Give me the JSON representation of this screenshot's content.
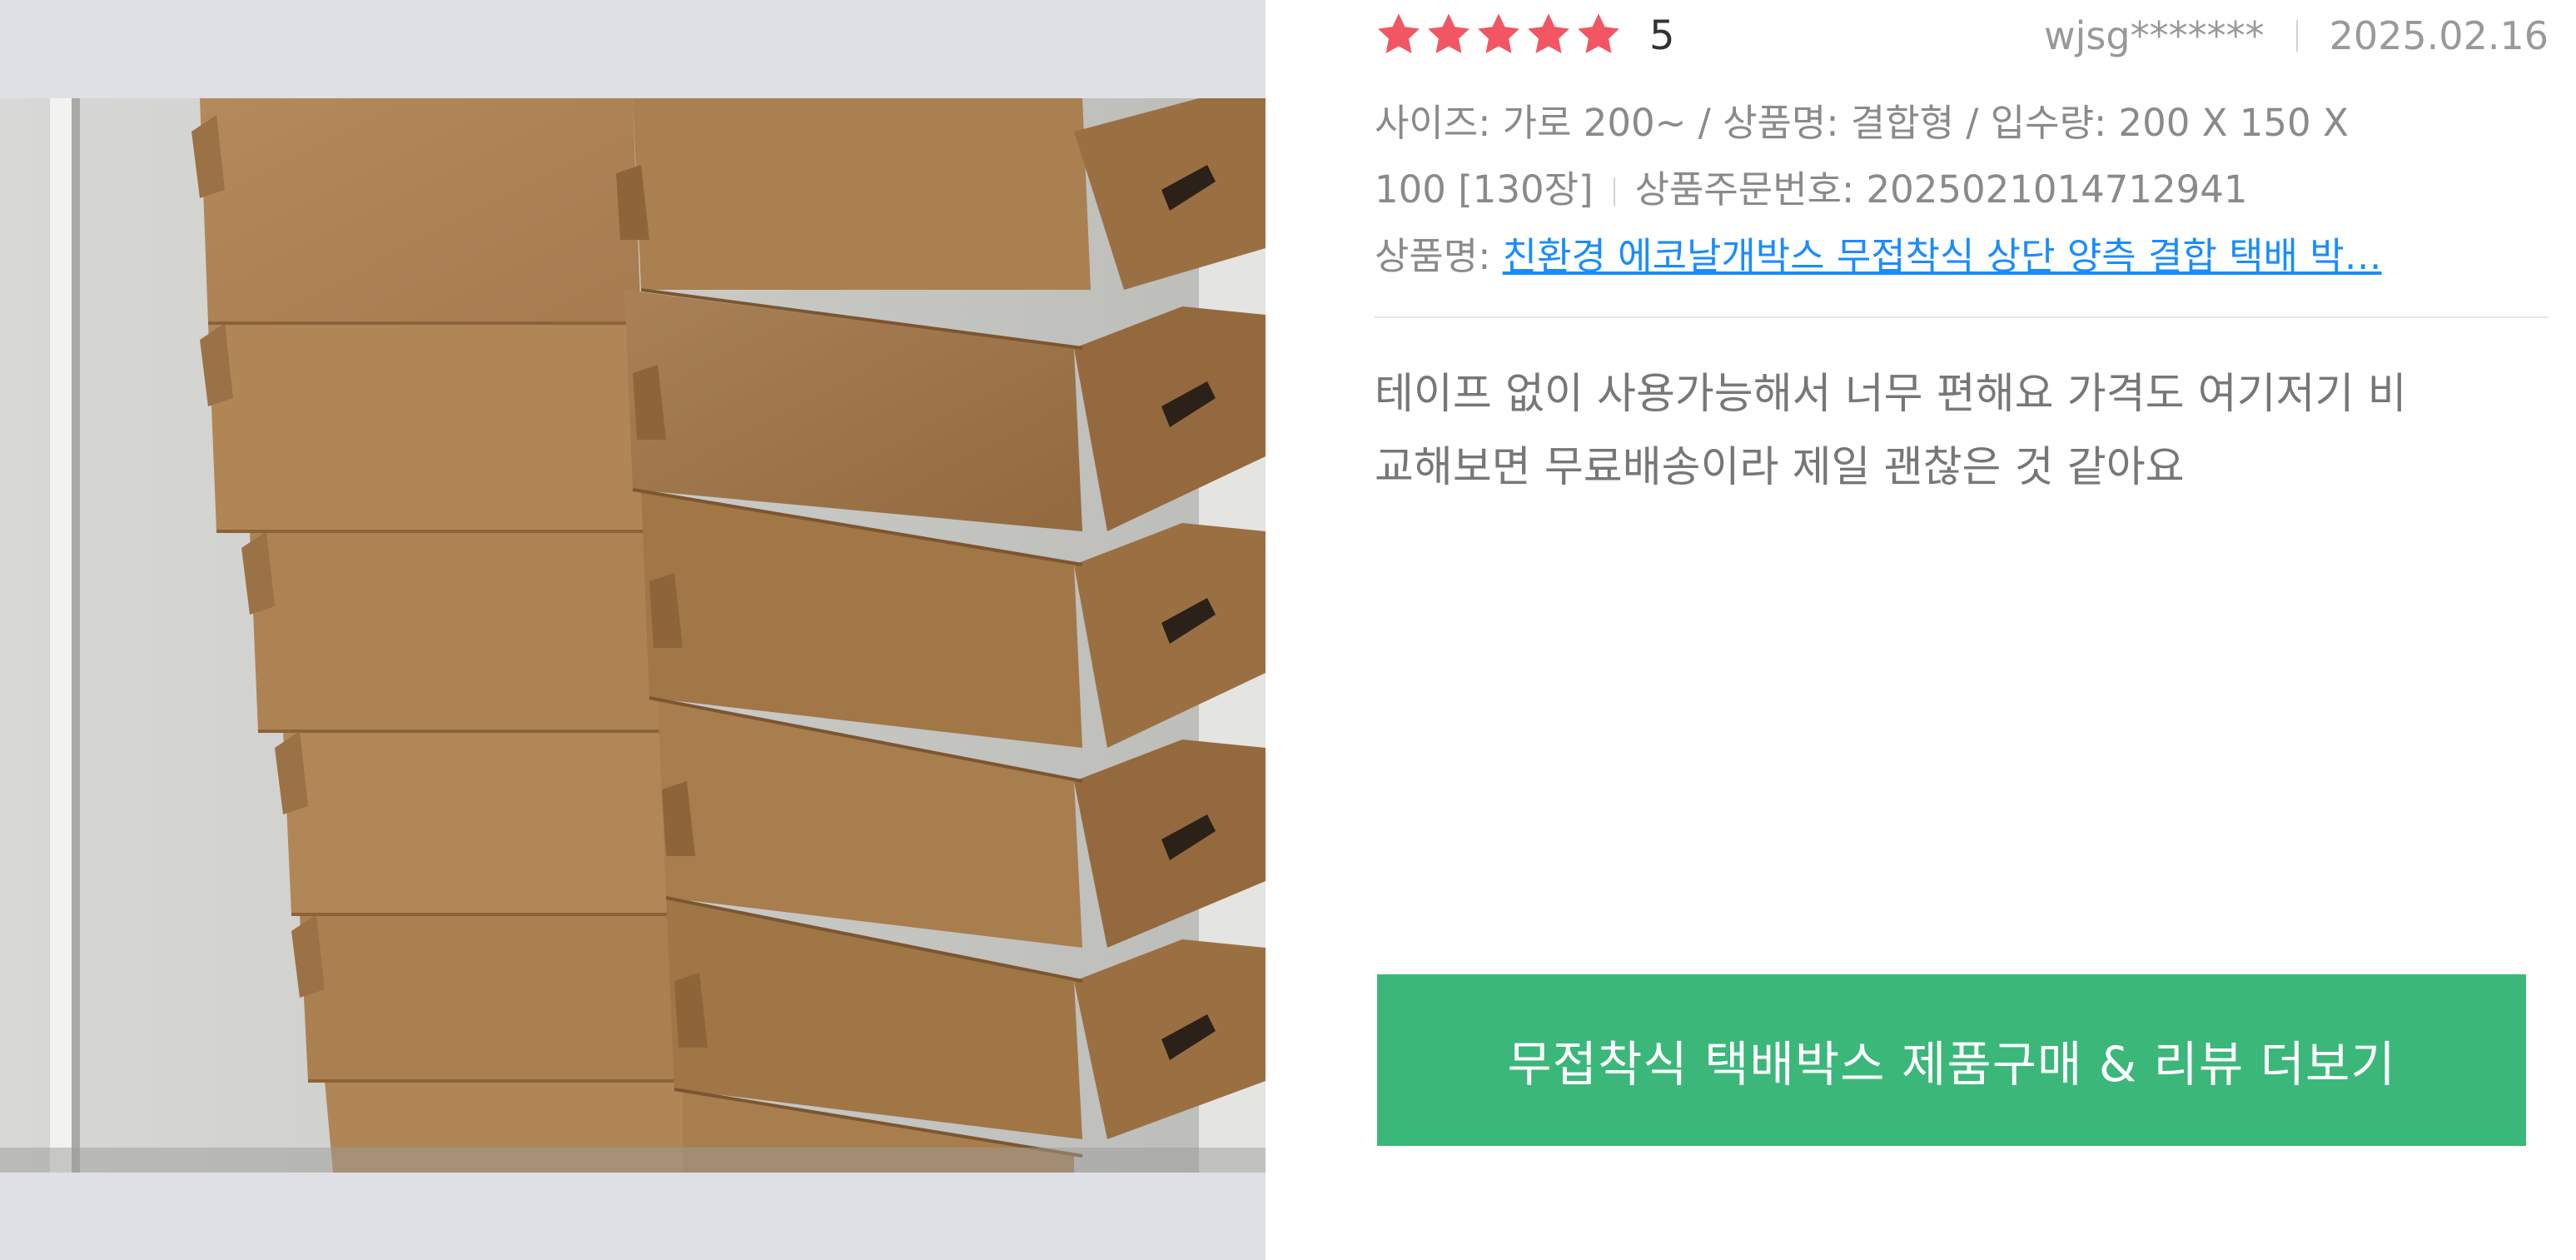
{
  "review": {
    "rating_stars": 5,
    "score": "5",
    "author": "wjsg*******",
    "date": "2025.02.16",
    "option_text": "사이즈: 가로 200~ / 상품명: 결합형 / 입수량: 200 X 150 X",
    "option_text_cont": "100 [130장]",
    "order_label": "상품주문번호: 2025021014712941",
    "product_label": "상품명: ",
    "product_name": "친환경 에코날개박스 무접착식 상단 양측 결합 택배 박…",
    "body_line1": "테이프 없이 사용가능해서 너무 편해요 가격도 여기저기 비",
    "body_line2": "교해보면 무료배송이라 제일 괜찮은 것 같아요"
  },
  "cta": {
    "label": "무접착식 택배박스 제품구매 & 리뷰 더보기"
  },
  "colors": {
    "star": "#f15662",
    "link": "#1a8cff",
    "cta_bg": "#3bb77a",
    "photo_bg": "#dfe0e6"
  },
  "icons": {
    "star": "star-icon"
  }
}
